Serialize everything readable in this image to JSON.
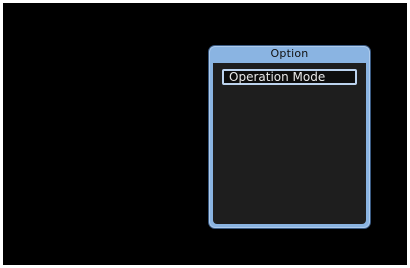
{
  "option_panel": {
    "title": "Option",
    "items": [
      {
        "label": "Operation Mode",
        "selected": true
      }
    ]
  },
  "colors": {
    "screen_background": "#000000",
    "panel_frame": "#8ab4e2",
    "panel_body": "#1e1e1e",
    "selection_border": "#bcd3ee"
  }
}
